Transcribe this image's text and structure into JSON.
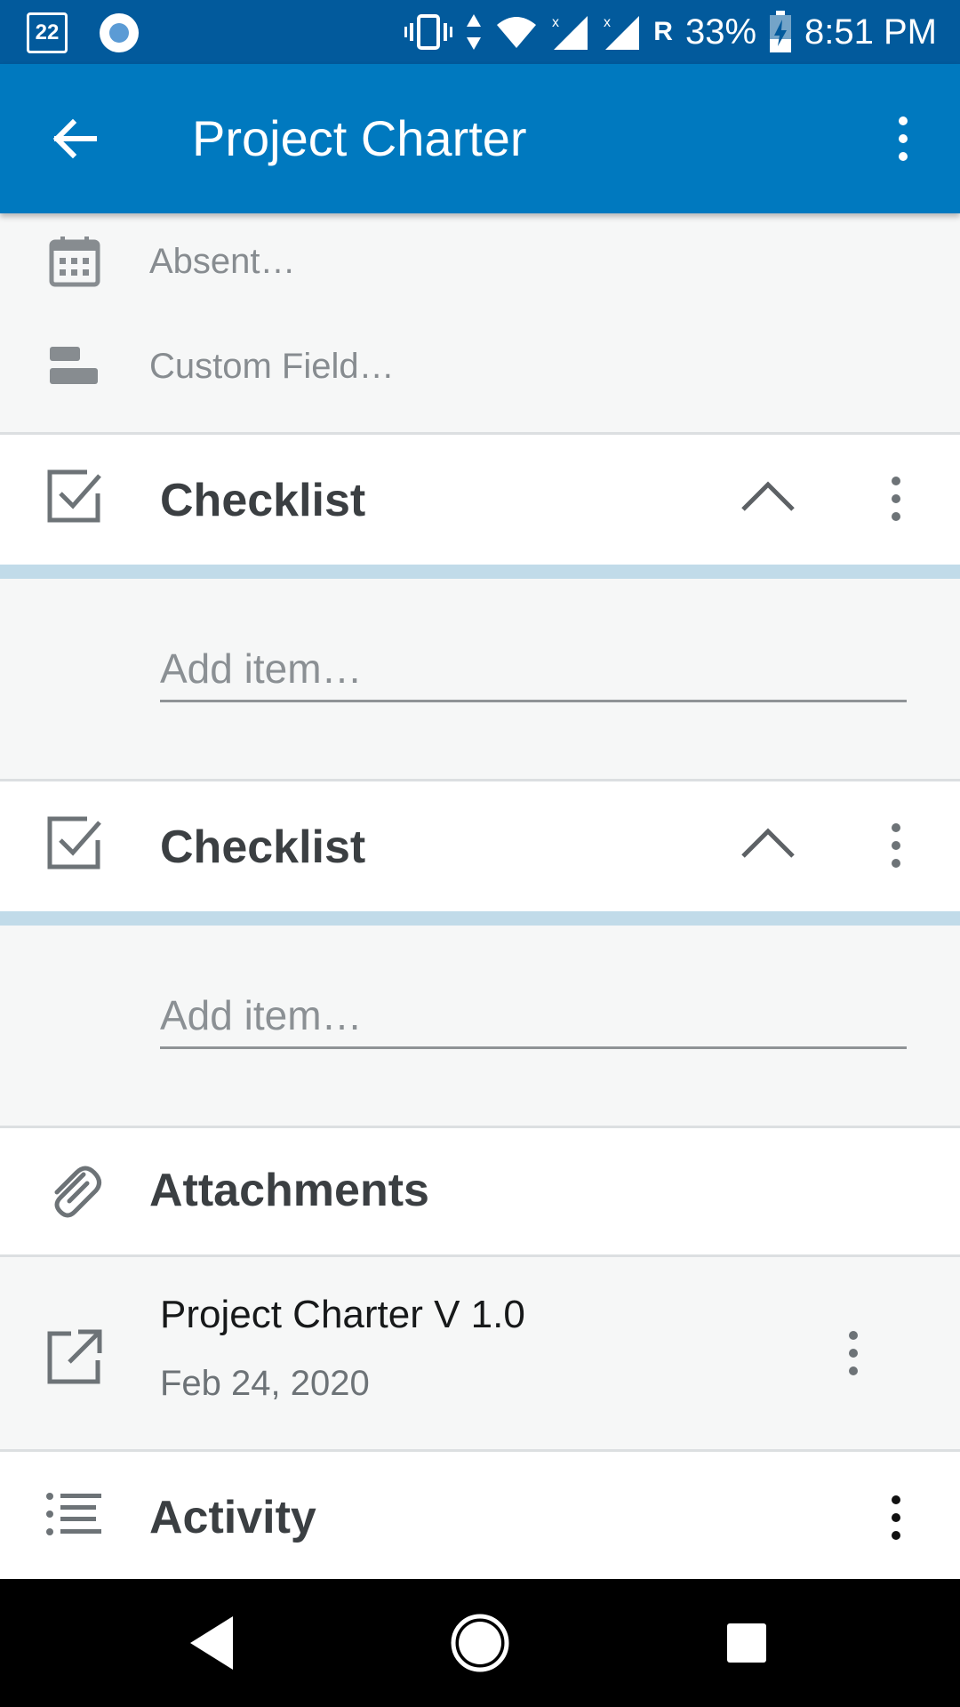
{
  "status_bar": {
    "notification_box_text": "22",
    "carrier_indicator": "R",
    "battery": "33%",
    "time": "8:51 PM"
  },
  "app_bar": {
    "title": "Project Charter",
    "back_icon": "arrow-left-icon",
    "menu_icon": "more-vert-icon"
  },
  "fields": [
    {
      "label": "Absent…",
      "icon": "calendar-icon"
    },
    {
      "label": "Custom Field…",
      "icon": "custom-field-icon"
    }
  ],
  "checklists": [
    {
      "title": "Checklist",
      "add_placeholder": "Add item…",
      "progress_percent": 0
    },
    {
      "title": "Checklist",
      "add_placeholder": "Add item…",
      "progress_percent": 0
    }
  ],
  "attachments": {
    "title": "Attachments",
    "items": [
      {
        "name": "Project Charter V 1.0",
        "date": "Feb 24, 2020"
      }
    ]
  },
  "activity": {
    "title": "Activity"
  },
  "colors": {
    "app_bar": "#0079bf",
    "status_bar": "#025a9c",
    "progress_track": "#c1dbe9",
    "background": "#f6f7f7"
  }
}
